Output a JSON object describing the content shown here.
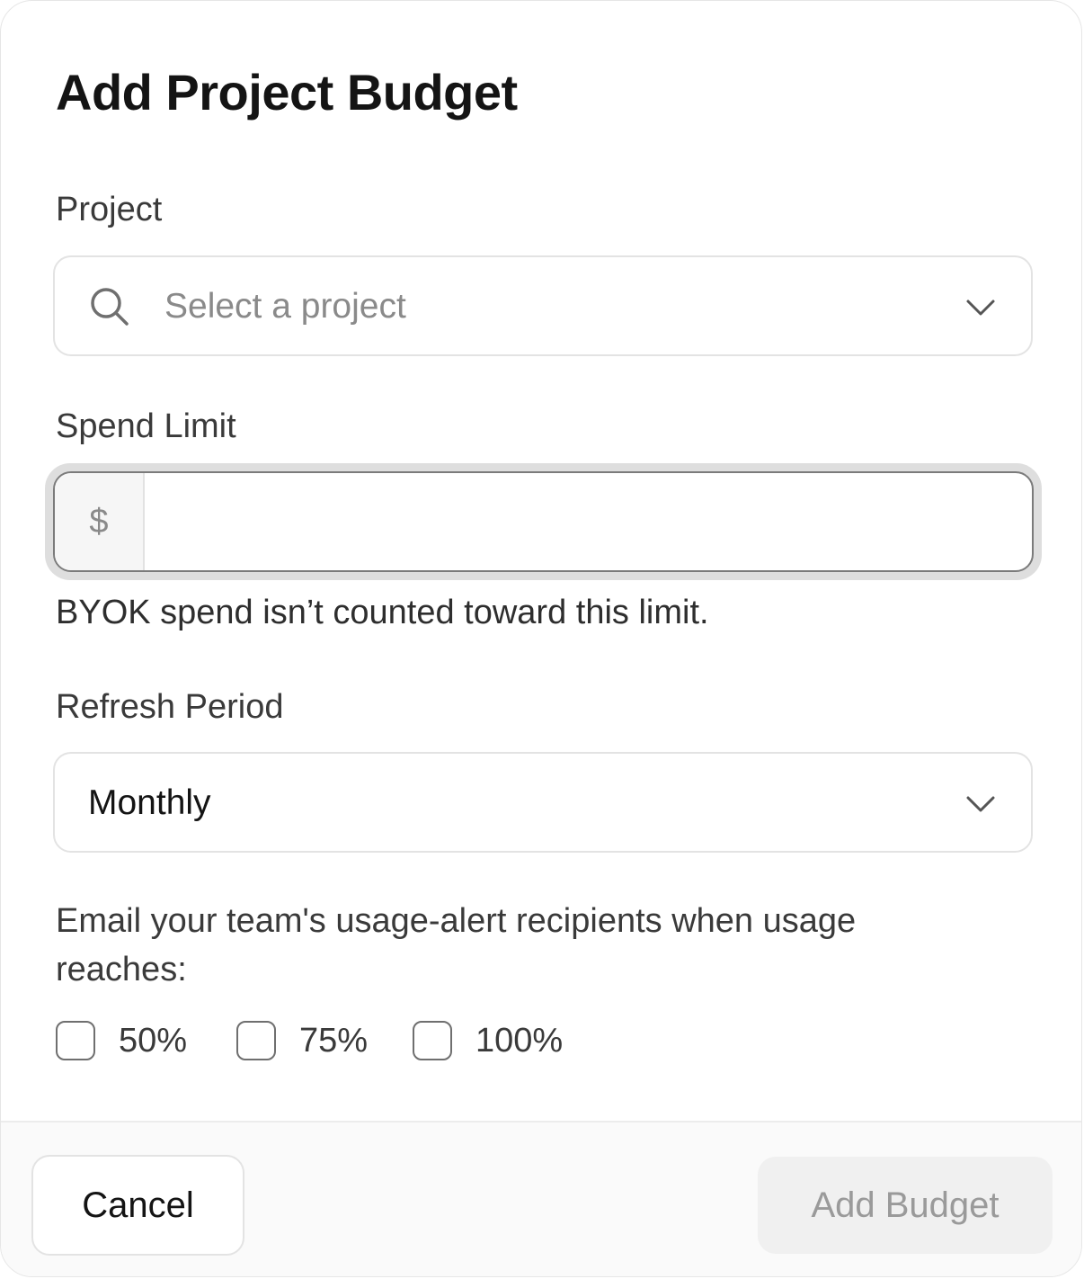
{
  "dialog": {
    "title": "Add Project Budget"
  },
  "project": {
    "label": "Project",
    "placeholder": "Select a project"
  },
  "spend_limit": {
    "label": "Spend Limit",
    "currency_symbol": "$",
    "value": "",
    "help_text": "BYOK spend isn’t counted toward this limit."
  },
  "refresh_period": {
    "label": "Refresh Period",
    "selected": "Monthly"
  },
  "alerts": {
    "text": "Email your team's usage-alert recipients when usage reaches:",
    "options": [
      {
        "label": "50%",
        "checked": false
      },
      {
        "label": "75%",
        "checked": false
      },
      {
        "label": "100%",
        "checked": false
      }
    ]
  },
  "footer": {
    "cancel_label": "Cancel",
    "submit_label": "Add Budget"
  },
  "icons": {
    "project_search": "search-icon",
    "project_dropdown": "chevron-down-icon",
    "refresh_dropdown": "chevron-down-icon"
  }
}
